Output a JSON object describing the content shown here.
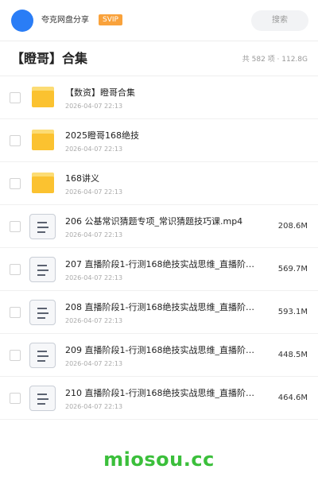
{
  "header": {
    "app_name": "夸克网盘分享",
    "badge": "SVIP",
    "search_label": "搜索"
  },
  "folder": {
    "title": "【瞪哥】合集",
    "summary": "共 582 项 · 112.8G"
  },
  "items": [
    {
      "type": "folder",
      "name": "【数资】瞪哥合集",
      "date": "2026-04-07 22:13",
      "size": ""
    },
    {
      "type": "folder",
      "name": "2025瞪哥168绝技",
      "date": "2026-04-07 22:13",
      "size": ""
    },
    {
      "type": "folder",
      "name": "168讲义",
      "date": "2026-04-07 22:13",
      "size": ""
    },
    {
      "type": "file",
      "name": "206 公基常识猜题专项_常识猜题技巧课.mp4",
      "date": "2026-04-07 22:13",
      "size": "208.6M"
    },
    {
      "type": "file",
      "name": "207 直播阶段1-行测168绝技实战思维_直播阶…",
      "date": "2026-04-07 22:13",
      "size": "569.7M"
    },
    {
      "type": "file",
      "name": "208 直播阶段1-行测168绝技实战思维_直播阶…",
      "date": "2026-04-07 22:13",
      "size": "593.1M"
    },
    {
      "type": "file",
      "name": "209 直播阶段1-行测168绝技实战思维_直播阶…",
      "date": "2026-04-07 22:13",
      "size": "448.5M"
    },
    {
      "type": "file",
      "name": "210 直播阶段1-行测168绝技实战思维_直播阶…",
      "date": "2026-04-07 22:13",
      "size": "464.6M"
    }
  ],
  "watermark": "miosou.cc",
  "colors": {
    "avatar": "#2a7df6",
    "badge": "#f9a23b",
    "folder": "#fbc230",
    "watermark": "#3bbf3b"
  }
}
